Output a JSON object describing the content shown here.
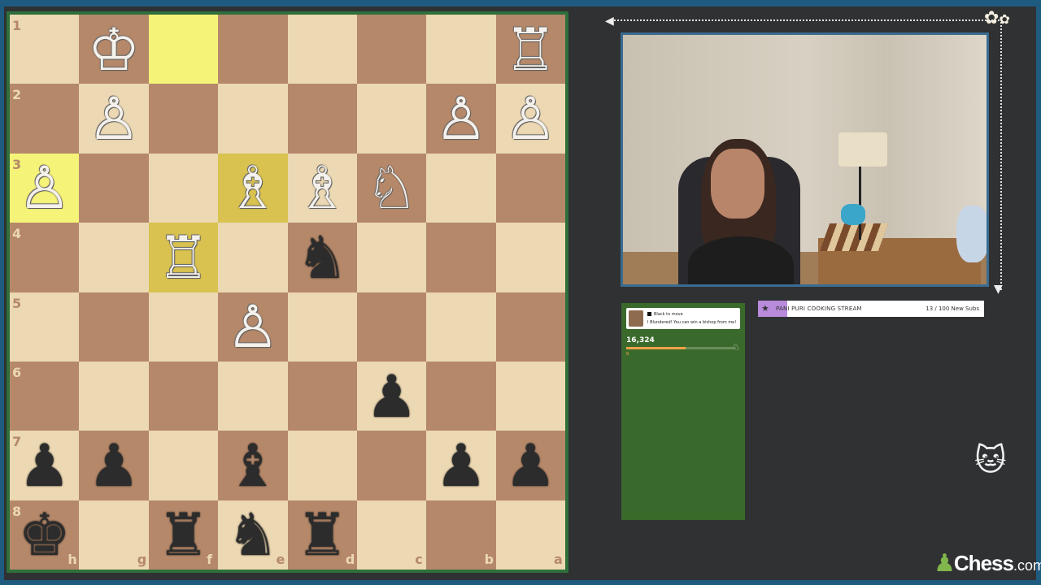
{
  "board": {
    "ranks": [
      "1",
      "2",
      "3",
      "4",
      "5",
      "6",
      "7",
      "8"
    ],
    "files": [
      "h",
      "g",
      "f",
      "e",
      "d",
      "c",
      "b",
      "a"
    ],
    "highlighted": [
      [
        2,
        0
      ],
      [
        2,
        3
      ]
    ],
    "pieces": [
      {
        "r": 0,
        "c": 1,
        "glyph": "♔",
        "color": "w",
        "name": "white-king"
      },
      {
        "r": 0,
        "c": 7,
        "glyph": "♖",
        "color": "w",
        "name": "white-rook"
      },
      {
        "r": 1,
        "c": 1,
        "glyph": "♙",
        "color": "w",
        "name": "white-pawn"
      },
      {
        "r": 1,
        "c": 6,
        "glyph": "♙",
        "color": "w",
        "name": "white-pawn"
      },
      {
        "r": 1,
        "c": 7,
        "glyph": "♙",
        "color": "w",
        "name": "white-pawn"
      },
      {
        "r": 2,
        "c": 0,
        "glyph": "♙",
        "color": "w",
        "name": "white-pawn"
      },
      {
        "r": 2,
        "c": 3,
        "glyph": "♗",
        "color": "w",
        "name": "white-bishop"
      },
      {
        "r": 2,
        "c": 4,
        "glyph": "♗",
        "color": "w",
        "name": "white-bishop"
      },
      {
        "r": 2,
        "c": 5,
        "glyph": "♘",
        "color": "w",
        "name": "white-knight"
      },
      {
        "r": 3,
        "c": 2,
        "glyph": "♖",
        "color": "w",
        "name": "white-rook"
      },
      {
        "r": 3,
        "c": 4,
        "glyph": "♞",
        "color": "b",
        "name": "black-knight"
      },
      {
        "r": 4,
        "c": 3,
        "glyph": "♙",
        "color": "w",
        "name": "white-pawn"
      },
      {
        "r": 5,
        "c": 5,
        "glyph": "♟",
        "color": "b",
        "name": "black-pawn"
      },
      {
        "r": 6,
        "c": 0,
        "glyph": "♟",
        "color": "b",
        "name": "black-pawn"
      },
      {
        "r": 6,
        "c": 1,
        "glyph": "♟",
        "color": "b",
        "name": "black-pawn"
      },
      {
        "r": 6,
        "c": 3,
        "glyph": "♝",
        "color": "b",
        "name": "black-bishop"
      },
      {
        "r": 6,
        "c": 6,
        "glyph": "♟",
        "color": "b",
        "name": "black-pawn"
      },
      {
        "r": 6,
        "c": 7,
        "glyph": "♟",
        "color": "b",
        "name": "black-pawn"
      },
      {
        "r": 7,
        "c": 0,
        "glyph": "♚",
        "color": "b",
        "name": "black-king"
      },
      {
        "r": 7,
        "c": 2,
        "glyph": "♜",
        "color": "b",
        "name": "black-rook"
      },
      {
        "r": 7,
        "c": 3,
        "glyph": "♞",
        "color": "b",
        "name": "black-knight"
      },
      {
        "r": 7,
        "c": 4,
        "glyph": "♜",
        "color": "b",
        "name": "black-rook"
      }
    ],
    "colors": {
      "light": "#ecd8b2",
      "dark": "#b5886a",
      "highlight": "#f5f378"
    }
  },
  "subgoal": {
    "title": "PANI PURI COOKING STREAM",
    "count": "13 / 100 New Subs",
    "progress": 0.13
  },
  "panel": {
    "notif_line1": "Black to move",
    "notif_line2": "I Blundered! You can win a bishop from me!",
    "score": "16,324",
    "progress": 0.55,
    "mini_label": "8"
  },
  "logo": {
    "text": "Chess",
    "suffix": ".com"
  },
  "icons": {
    "flowers": "flower-icon",
    "cat": "cat-icon",
    "star": "star-icon",
    "chess-piece": "pawn-icon"
  }
}
